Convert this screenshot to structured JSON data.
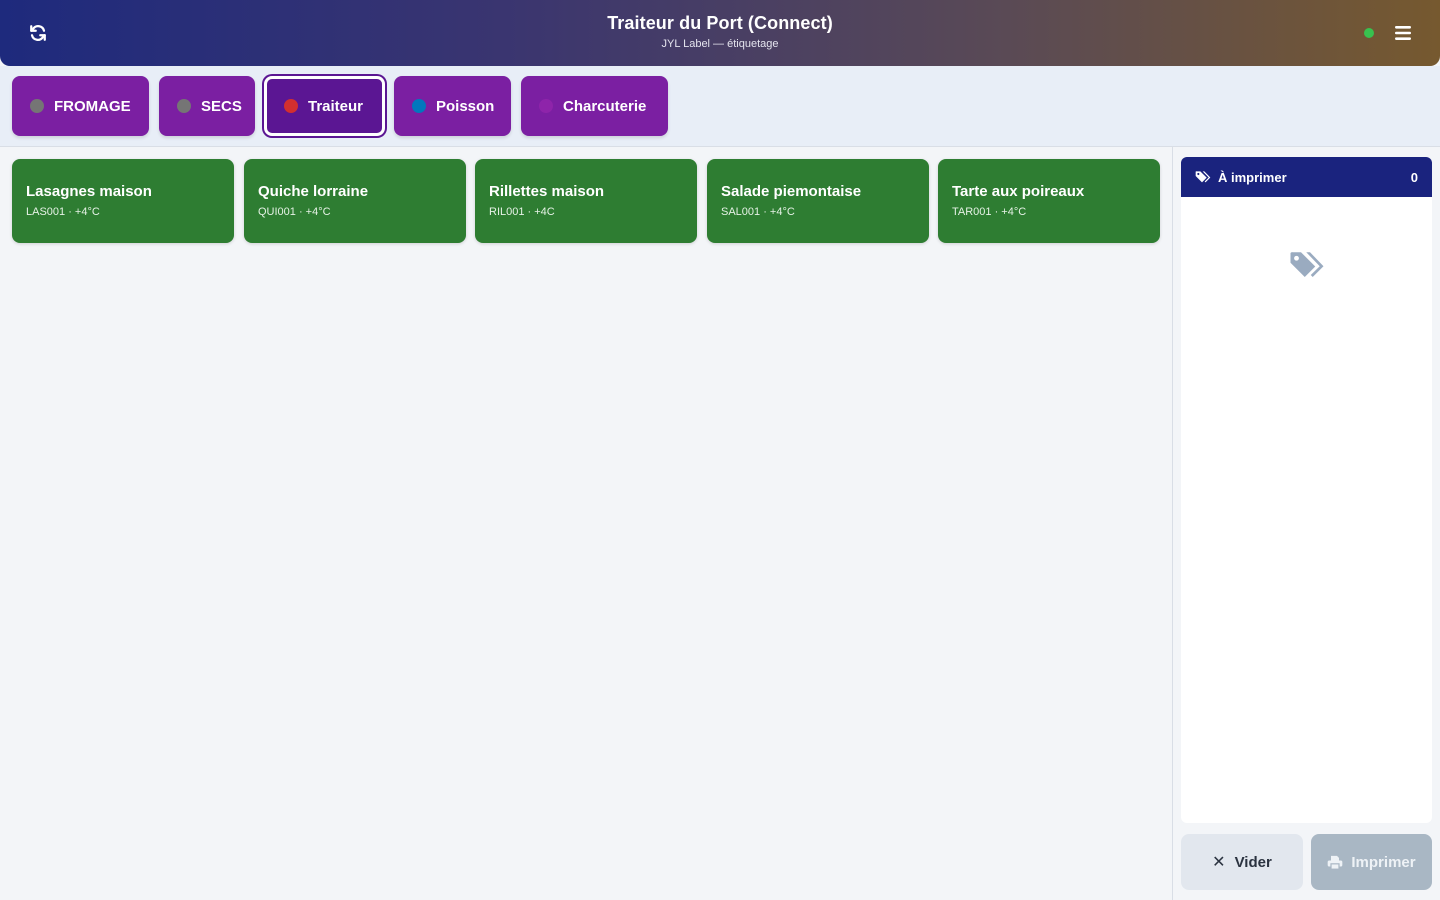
{
  "header": {
    "title": "Traiteur du Port (Connect)",
    "subtitle": "JYL Label — étiquetage",
    "status_color": "#38c24f",
    "refresh_icon": "refresh-icon",
    "menu_icon": "hamburger-menu-icon"
  },
  "categories": [
    {
      "label": "FROMAGE",
      "dot_color": "#757575",
      "active": false
    },
    {
      "label": "SECS",
      "dot_color": "#757575",
      "active": false
    },
    {
      "label": "Traiteur",
      "dot_color": "#d32f2f",
      "active": true
    },
    {
      "label": "Poisson",
      "dot_color": "#0277bd",
      "active": false
    },
    {
      "label": "Charcuterie",
      "dot_color": "#8e24aa",
      "active": false
    }
  ],
  "products": [
    {
      "name": "Lasagnes maison",
      "info": "LAS001 · +4°C"
    },
    {
      "name": "Quiche lorraine",
      "info": "QUI001 · +4°C"
    },
    {
      "name": "Rillettes maison",
      "info": "RIL001 · +4C"
    },
    {
      "name": "Salade piemontaise",
      "info": "SAL001 · +4°C"
    },
    {
      "name": "Tarte aux poireaux",
      "info": "TAR001 · +4°C"
    }
  ],
  "queue": {
    "title": "À imprimer",
    "count": "0",
    "icon": "tags-icon",
    "empty_icon": "tags-icon"
  },
  "actions": {
    "clear_label": "Vider",
    "print_label": "Imprimer"
  },
  "colors": {
    "category_bg": "#7b1fa2",
    "category_active_bg": "#5b1693",
    "product_bg": "#2e7d32",
    "queue_header_bg": "#1a237e"
  }
}
